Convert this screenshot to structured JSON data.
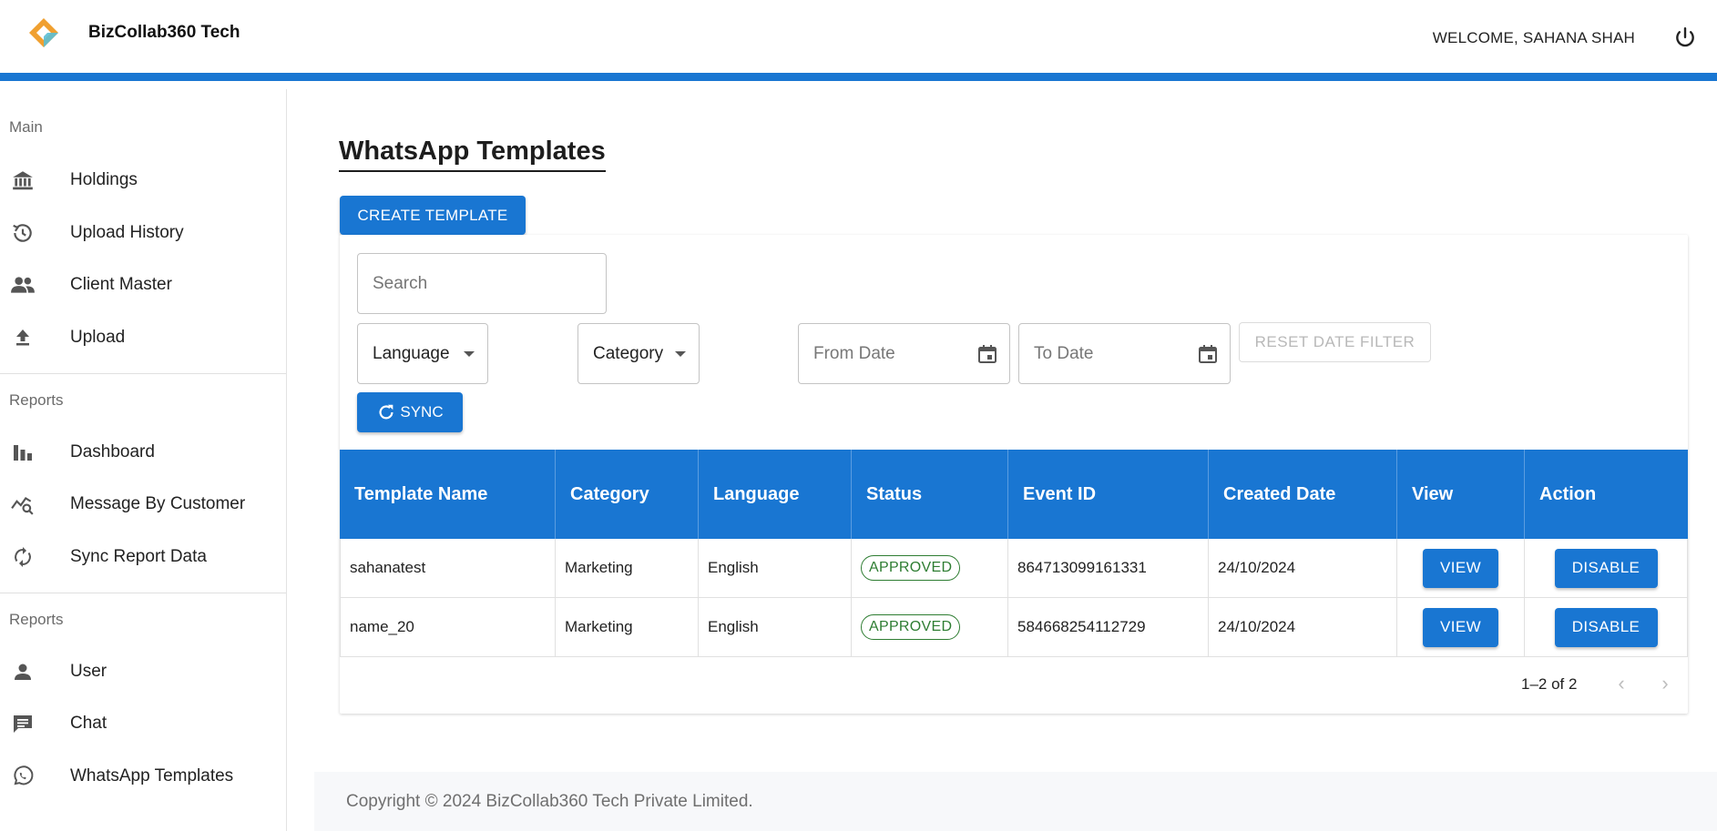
{
  "header": {
    "brand": "BizCollab360 Tech",
    "welcome": "WELCOME, SAHANA SHAH",
    "accent_color": "#1976d2"
  },
  "sidebar": {
    "sections": [
      {
        "label": "Main",
        "items": [
          {
            "label": "Holdings",
            "icon": "bank-icon"
          },
          {
            "label": "Upload History",
            "icon": "history-icon"
          },
          {
            "label": "Client Master",
            "icon": "people-icon"
          },
          {
            "label": "Upload",
            "icon": "upload-icon"
          }
        ]
      },
      {
        "label": "Reports",
        "items": [
          {
            "label": "Dashboard",
            "icon": "bar-chart-icon"
          },
          {
            "label": "Message By Customer",
            "icon": "query-stats-icon"
          },
          {
            "label": "Sync Report Data",
            "icon": "sync-icon"
          }
        ]
      },
      {
        "label": "Reports",
        "items": [
          {
            "label": "User",
            "icon": "person-icon"
          },
          {
            "label": "Chat",
            "icon": "chat-icon"
          },
          {
            "label": "WhatsApp Templates",
            "icon": "whatsapp-icon"
          }
        ]
      }
    ]
  },
  "main": {
    "title": "WhatsApp Templates",
    "create_button": "CREATE TEMPLATE",
    "filters": {
      "search_placeholder": "Search",
      "language_label": "Language",
      "category_label": "Category",
      "from_date_placeholder": "From Date",
      "to_date_placeholder": "To Date",
      "reset_label": "RESET DATE FILTER",
      "sync_label": "SYNC"
    },
    "table": {
      "columns": [
        "Template Name",
        "Category",
        "Language",
        "Status",
        "Event ID",
        "Created Date",
        "View",
        "Action"
      ],
      "rows": [
        {
          "name": "sahanatest",
          "category": "Marketing",
          "language": "English",
          "status": "APPROVED",
          "event_id": "864713099161331",
          "created": "24/10/2024",
          "view": "VIEW",
          "action": "DISABLE"
        },
        {
          "name": "name_20",
          "category": "Marketing",
          "language": "English",
          "status": "APPROVED",
          "event_id": "584668254112729",
          "created": "24/10/2024",
          "view": "VIEW",
          "action": "DISABLE"
        }
      ]
    },
    "pagination": "1–2 of 2"
  },
  "footer": {
    "copyright": "Copyright © 2024 BizCollab360 Tech Private Limited."
  }
}
